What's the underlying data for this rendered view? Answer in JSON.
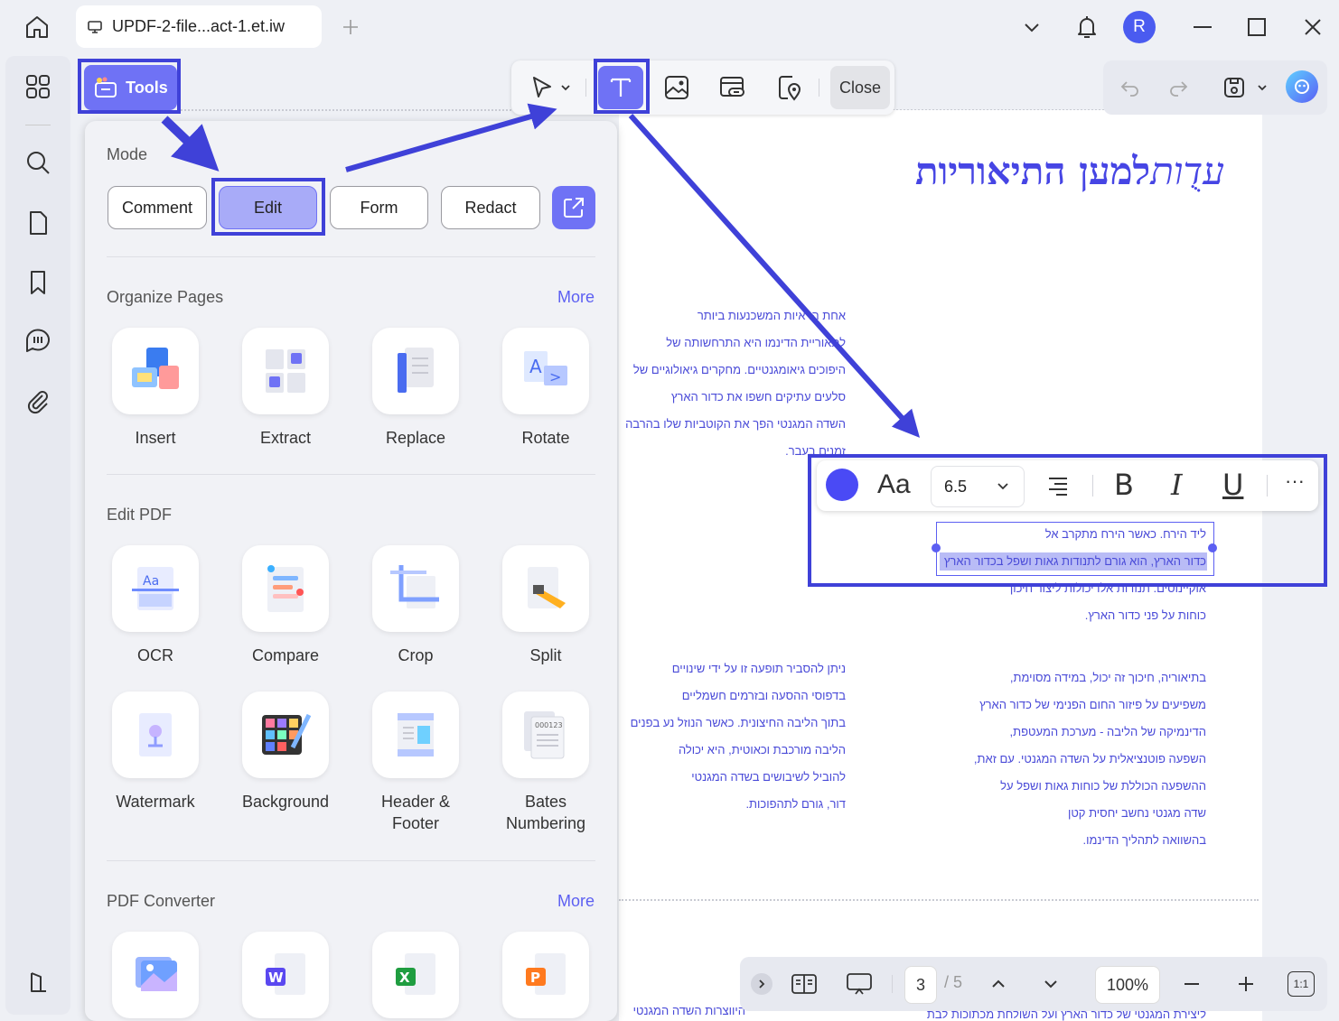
{
  "titlebar": {
    "tab_label": "UPDF-2-file...act-1.et.iw",
    "avatar_letter": "R"
  },
  "toolbar": {
    "tools_label": "Tools",
    "close_label": "Close"
  },
  "panel": {
    "mode_title": "Mode",
    "modes": [
      "Comment",
      "Edit",
      "Form",
      "Redact"
    ],
    "organize_title": "Organize Pages",
    "organize_more": "More",
    "organize_tools": [
      "Insert",
      "Extract",
      "Replace",
      "Rotate"
    ],
    "edit_title": "Edit PDF",
    "edit_tools_row1": [
      "OCR",
      "Compare",
      "Crop",
      "Split"
    ],
    "edit_tools_row2": [
      "Watermark",
      "Background",
      "Header &\nFooter",
      "Bates\nNumbering"
    ],
    "converter_title": "PDF Converter",
    "converter_more": "More"
  },
  "document": {
    "title_italic": "עדֻות",
    "title_bold": "למען התיאוריות",
    "col_left_1": [
      "אחת הראיות המשכנעות ביותר",
      "לתאוריית הדינמו היא התרחשותה של",
      "היפוכים גיאומגנטיים. מחקרים גיאולוגיים של",
      "סלעים עתיקים חשפו את כדור הארץ",
      "השדה המגנטי הפך את הקוטביות שלו בהרבה",
      "זמנים בעבר."
    ],
    "col_right_1": [
      "ליד הירח. כאשר הירח מתקרב אל",
      "כדור הארץ, הוא גורם לתנודות גאות ושפל בכדור הארץ",
      "אוקיינוסים. תנודות אלו יכולות ליצור חיכוך",
      "כוחות על פני כדור הארץ."
    ],
    "col_left_2": [
      "ניתן להסביר תופעה זו על ידי שינויים",
      "בדפוסי ההסעה ובזרמים חשמליים",
      "בתוך הליבה החיצונית. כאשר הנוזל נע בפנים",
      "הליבה מורכבת וכאוטית, היא יכולה",
      "להוביל לשיבושים בשדה המגנטי",
      "דור, גורם לתהפוכות."
    ],
    "col_right_2": [
      "בתיאוריה, חיכוך זה יכול, במידה מסוימת,",
      "משפיעים על פיזור החום הפנימי של כדור הארץ",
      "הדינמיקה של הליבה - מערכת המעטפת,",
      "השפעה פוטנציאלית על השדה המגנטי. עם זאת,",
      "ההשפעה הכוללת של כוחות גאות ושפל על",
      "שדה מגנטי נחשב יחסית קטן",
      "בהשוואה לתהליך הדינמו."
    ],
    "bottom_left": "היווצרות השדה המגנטי",
    "bottom_right": "ליצירת המגנטי של כדור הארץ ועל השולחת מכתוכות לבת"
  },
  "format_toolbar": {
    "font_label": "Aa",
    "size_value": "6.5",
    "bold": "B",
    "italic": "I",
    "underline": "U",
    "more": "···",
    "color": "#4a4af5"
  },
  "bottom_bar": {
    "page_current": "3",
    "page_total": "/ 5",
    "zoom": "100%",
    "fit_label": "1:1"
  },
  "colors": {
    "accent": "#6f72f5",
    "highlight": "#3f41d8",
    "doc_text": "#4a4bd8"
  }
}
